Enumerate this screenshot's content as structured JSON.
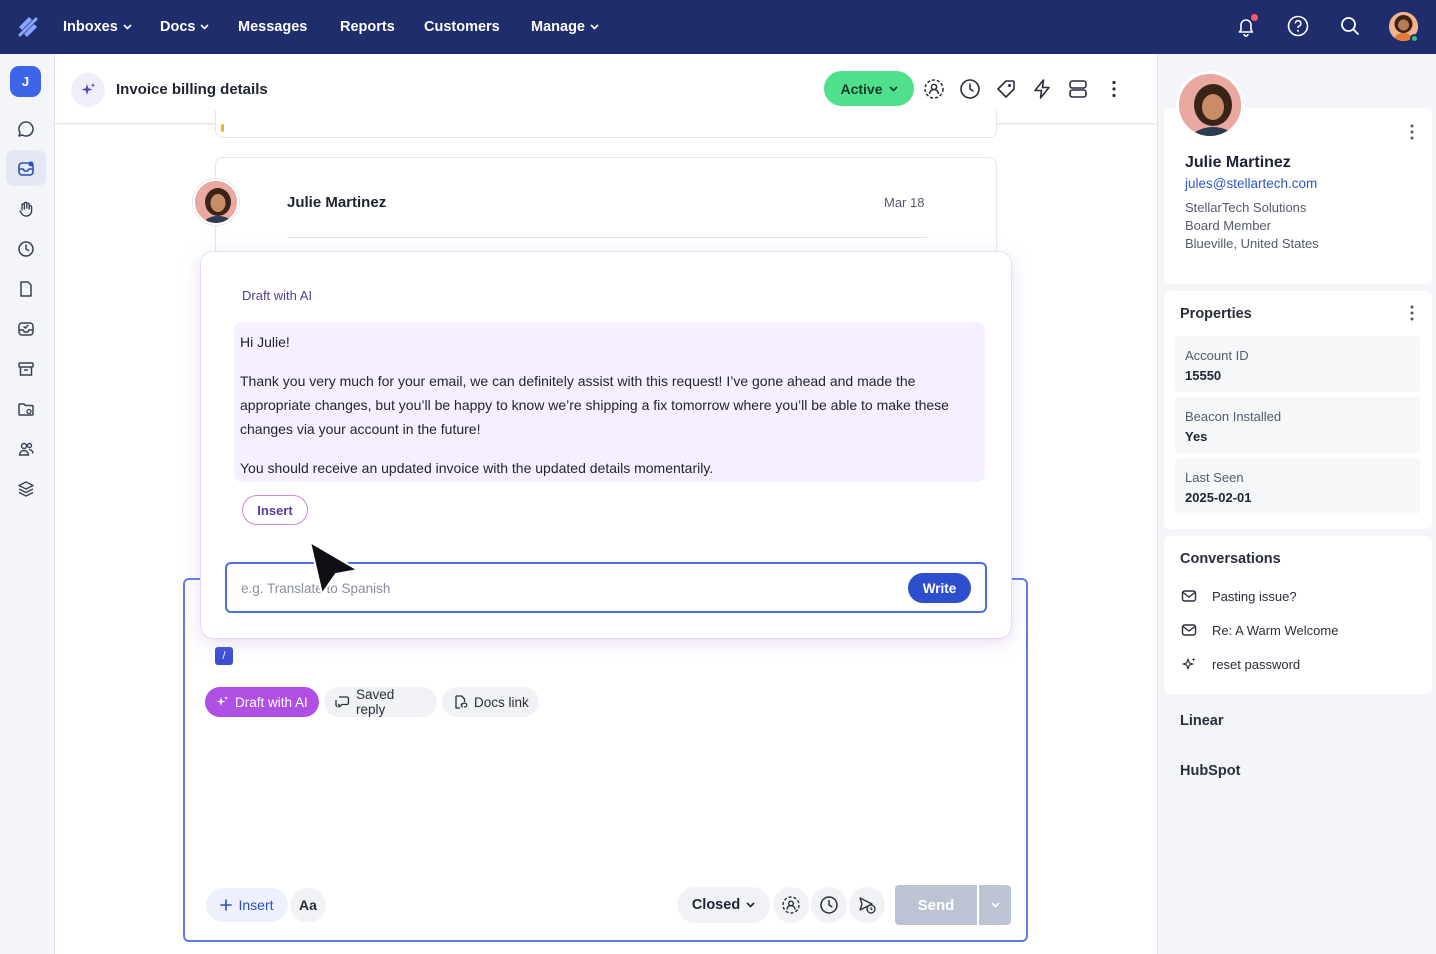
{
  "nav": {
    "items": [
      {
        "label": "Inboxes",
        "has_menu": true
      },
      {
        "label": "Docs",
        "has_menu": true
      },
      {
        "label": "Messages",
        "has_menu": false
      },
      {
        "label": "Reports",
        "has_menu": false
      },
      {
        "label": "Customers",
        "has_menu": false
      },
      {
        "label": "Manage",
        "has_menu": true
      }
    ],
    "right_icons": [
      "bell-icon",
      "help-icon",
      "search-icon",
      "user-avatar"
    ]
  },
  "rail": {
    "user_initial": "J",
    "icons": [
      "chat-icon",
      "inbox-icon",
      "hand-icon",
      "clock-icon",
      "document-icon",
      "inbox-check-icon",
      "archive-icon",
      "folder-settings-icon",
      "people-icon",
      "layers-icon"
    ]
  },
  "conversation": {
    "title": "Invoice billing details",
    "status": "Active",
    "header_icons": [
      "assign-icon",
      "snooze-icon",
      "tag-icon",
      "workflow-icon",
      "layout-icon",
      "more-icon"
    ],
    "message": {
      "sender": "Julie Martinez",
      "date": "Mar 18"
    }
  },
  "ai_draft": {
    "label": "Draft with AI",
    "paragraphs": [
      "Hi Julie!",
      "Thank you very much for your email, we can definitely assist with this request! I’ve gone ahead and made the appropriate changes, but you’ll be happy to know we’re shipping a fix tomorrow where you’ll be able to make these changes via your account in the future!",
      "You should receive an updated invoice with the updated details momentarily."
    ],
    "insert_label": "Insert",
    "prompt_placeholder": "e.g. Translate to Spanish",
    "write_label": "Write"
  },
  "editor": {
    "slash_chip": "/",
    "chips": {
      "draft_ai": "Draft with AI",
      "saved_reply": "Saved reply",
      "docs_link": "Docs link"
    },
    "insert_label": "Insert",
    "format_label": "Aa",
    "status_label": "Closed",
    "send_label": "Send"
  },
  "customer": {
    "name": "Julie Martinez",
    "email": "jules@stellartech.com",
    "company": "StellarTech Solutions",
    "role": "Board Member",
    "location": "Blueville, United States"
  },
  "properties": {
    "title": "Properties",
    "items": [
      {
        "label": "Account ID",
        "value": "15550"
      },
      {
        "label": "Beacon Installed",
        "value": "Yes"
      },
      {
        "label": "Last Seen",
        "value": "2025-02-01"
      }
    ]
  },
  "conversations": {
    "title": "Conversations",
    "items": [
      {
        "label": "Pasting issue?",
        "icon": "mail-icon"
      },
      {
        "label": "Re: A Warm Welcome",
        "icon": "mail-icon"
      },
      {
        "label": "reset password",
        "icon": "sparkle-icon"
      }
    ]
  },
  "apps": [
    "Linear",
    "HubSpot"
  ],
  "colors": {
    "nav_bg": "#1f2d6d",
    "active_status": "#4fe08e",
    "ai_purple": "#b04fe4",
    "primary_blue": "#2e4fcb"
  }
}
